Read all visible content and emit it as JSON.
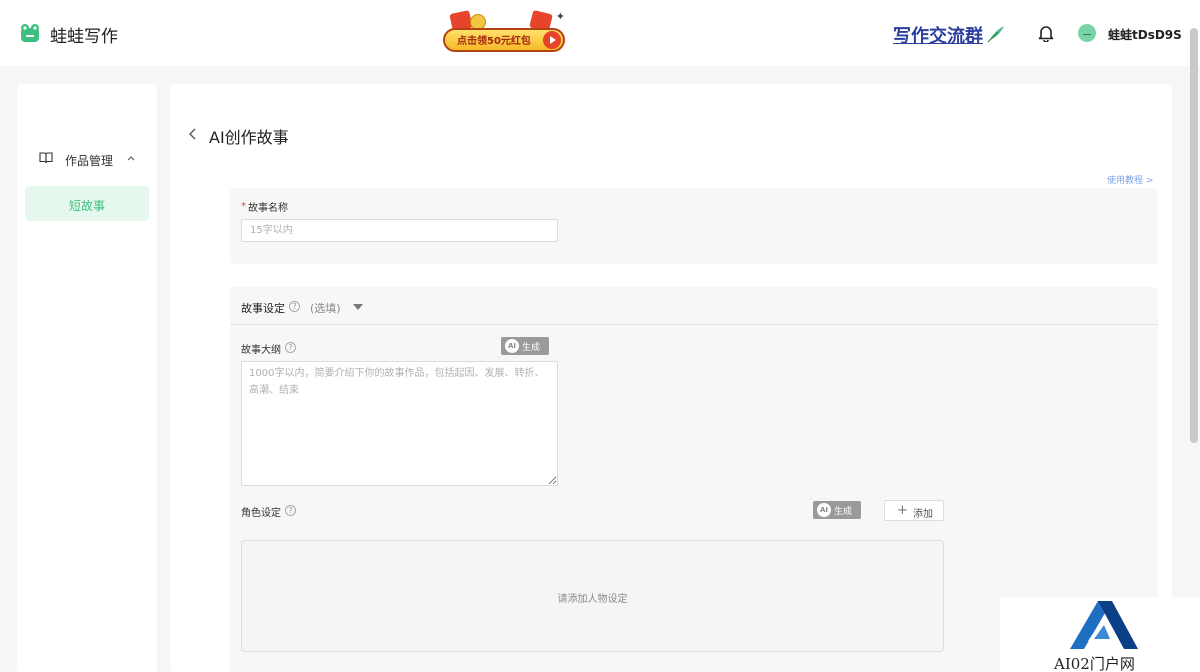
{
  "header": {
    "app_name": "蛙蛙写作",
    "promo_label": "点击领50元红包",
    "group_link": "写作交流群",
    "username": "蛙蛙tDsD9S"
  },
  "sidebar": {
    "group_label": "作品管理",
    "items": [
      {
        "label": "短故事"
      }
    ]
  },
  "main": {
    "title": "AI创作故事",
    "tutorial_link": "使用教程 >",
    "story_name": {
      "required_mark": "*",
      "label": "故事名称",
      "placeholder": "15字以内",
      "value": ""
    },
    "settings": {
      "title": "故事设定",
      "optional_label": "(选填)",
      "outline": {
        "label": "故事大纲",
        "generate_label": "生成",
        "placeholder": "1000字以内，简要介绍下你的故事作品，包括起因、发展、转折、高潮、结束",
        "value": ""
      },
      "roles": {
        "label": "角色设定",
        "generate_label": "生成",
        "add_label": "添加",
        "empty_text": "请添加人物设定"
      }
    }
  },
  "watermark": {
    "text": "AI02门户网"
  },
  "colors": {
    "accent": "#3fbf7f",
    "accent_bg": "#e6f8ee",
    "link": "#7ca4e8",
    "required": "#e5453a",
    "generate_button": "#9a9a9a"
  }
}
